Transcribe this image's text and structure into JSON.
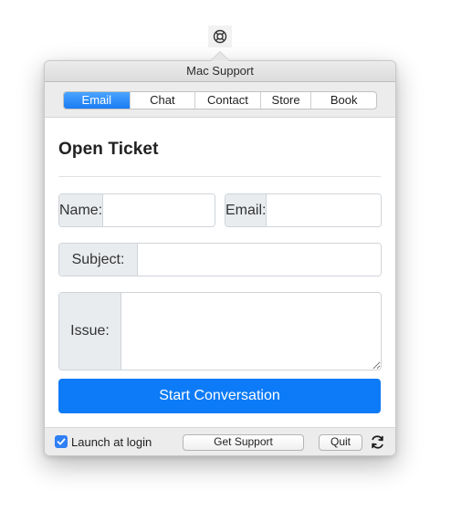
{
  "popover": {
    "title": "Mac Support"
  },
  "tabs": [
    {
      "label": "Email",
      "active": true
    },
    {
      "label": "Chat",
      "active": false
    },
    {
      "label": "Contact",
      "active": false
    },
    {
      "label": "Store",
      "active": false
    },
    {
      "label": "Book",
      "active": false
    }
  ],
  "form": {
    "heading": "Open Ticket",
    "name_label": "Name:",
    "name_value": "",
    "email_label": "Email:",
    "email_value": "",
    "subject_label": "Subject:",
    "subject_value": "",
    "issue_label": "Issue:",
    "issue_value": "",
    "submit_label": "Start Conversation"
  },
  "footer": {
    "launch_label": "Launch at login",
    "launch_checked": true,
    "get_support_label": "Get Support",
    "quit_label": "Quit"
  },
  "colors": {
    "accent": "#0d7bf7",
    "addon_bg": "#e9ecef"
  }
}
